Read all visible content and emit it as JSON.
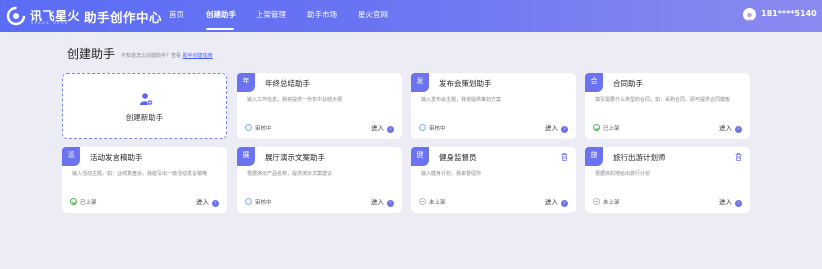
{
  "header": {
    "brand": "讯飞星火",
    "brand_sub": "SPARK DESK",
    "product": "助手创作中心",
    "nav": [
      {
        "label": "首页"
      },
      {
        "label": "创建助手"
      },
      {
        "label": "上架管理"
      },
      {
        "label": "助手市场"
      },
      {
        "label": "星火官网"
      }
    ],
    "active_nav": "创建助手",
    "user_phone": "181****5140"
  },
  "page": {
    "title": "创建助手",
    "hint_text": "不知道怎么创建助手？查看",
    "hint_link": "助手创建指南"
  },
  "create_card": {
    "label": "创建新助手",
    "icon": "add-user-icon"
  },
  "cards": [
    {
      "badge": "年",
      "title": "年终总结助手",
      "desc": "输入工作信息，我将提供一份年中总结大纲",
      "status": "审核中",
      "enter": "进入",
      "deletable": false
    },
    {
      "badge": "发",
      "title": "发布会策划助手",
      "desc": "输入发布会主题，我将提供策划方案",
      "status": "审核中",
      "enter": "进入",
      "deletable": false
    },
    {
      "badge": "合",
      "title": "合同助手",
      "desc": "填写需要什么类型的合同，如：采购合同，即可提供合同模板",
      "status": "已上架",
      "enter": "进入",
      "deletable": false
    },
    {
      "badge": "活",
      "title": "活动发言稿助手",
      "desc": "输入活动主题，如：业绩复盘会，我能写出一篇活动发言稿哦",
      "status": "已上架",
      "enter": "进入",
      "deletable": false
    },
    {
      "badge": "展",
      "title": "展厅演示文案助手",
      "desc": "根据演示产品名称，提供演示文案建议",
      "status": "审核中",
      "enter": "进入",
      "deletable": false
    },
    {
      "badge": "健",
      "title": "健身监督员",
      "desc": "输入健身计划，我来督促你",
      "status": "未上架",
      "enter": "进入",
      "deletable": true
    },
    {
      "badge": "旅",
      "title": "旅行出游计划师",
      "desc": "根据目的地给出旅行计划",
      "status": "未上架",
      "enter": "进入",
      "deletable": true
    }
  ],
  "colors": {
    "accent": "#6c73f0",
    "header_start": "#5b6df6",
    "header_end": "#8a8af0",
    "page_bg": "#ececf4"
  }
}
